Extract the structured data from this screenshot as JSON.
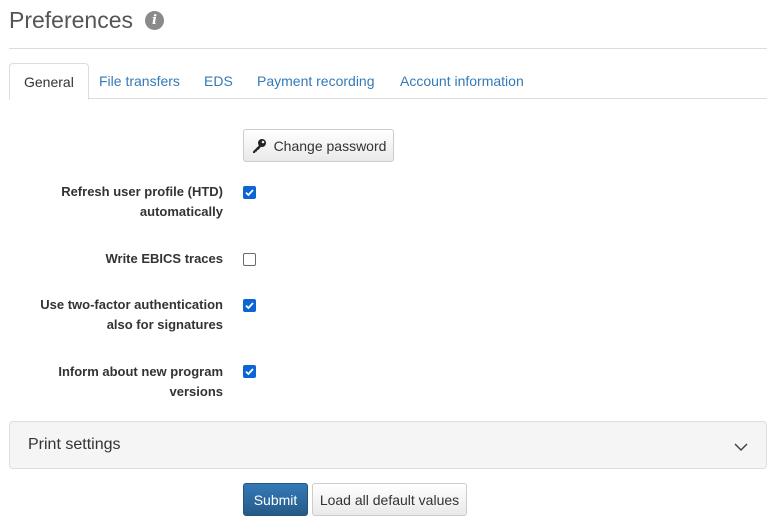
{
  "page": {
    "title": "Preferences",
    "info_icon": "info-icon"
  },
  "tabs": [
    {
      "label": "General",
      "active": true
    },
    {
      "label": "File transfers",
      "active": false
    },
    {
      "label": "EDS",
      "active": false
    },
    {
      "label": "Payment recording",
      "active": false
    },
    {
      "label": "Account information",
      "active": false
    }
  ],
  "general": {
    "change_password_label": "Change password",
    "change_password_icon": "key-icon",
    "options": [
      {
        "label_lines": [
          "Refresh user profile (HTD)",
          "automatically"
        ],
        "checked": true
      },
      {
        "label_lines": [
          "Write EBICS traces"
        ],
        "checked": false
      },
      {
        "label_lines": [
          "Use two-factor authentication",
          "also for signatures"
        ],
        "checked": true
      },
      {
        "label_lines": [
          "Inform about new program",
          "versions"
        ],
        "checked": true
      }
    ]
  },
  "print_settings": {
    "title": "Print settings",
    "expanded": false,
    "icon": "chevron-down-icon"
  },
  "actions": {
    "submit_label": "Submit",
    "load_defaults_label": "Load all default values"
  },
  "colors": {
    "link": "#337ab7",
    "primary": "#2e6da4",
    "checkbox": "#0b66d4"
  }
}
